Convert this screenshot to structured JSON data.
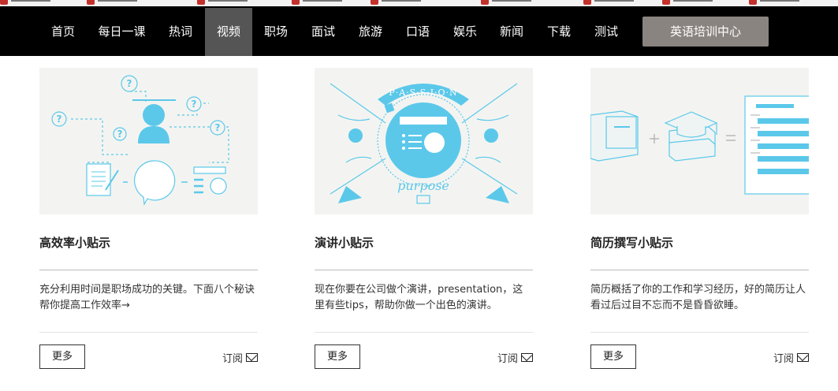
{
  "nav": {
    "items": [
      {
        "label": "首页"
      },
      {
        "label": "每日一课"
      },
      {
        "label": "热词"
      },
      {
        "label": "视频"
      },
      {
        "label": "职场"
      },
      {
        "label": "面试"
      },
      {
        "label": "旅游"
      },
      {
        "label": "口语"
      },
      {
        "label": "娱乐"
      },
      {
        "label": "新闻"
      },
      {
        "label": "下载"
      },
      {
        "label": "测试"
      }
    ],
    "active": "视频",
    "cta_label": "英语培训中心"
  },
  "cards": [
    {
      "title": "高效率小贴示",
      "desc": "充分利用时间是职场成功的关键。下面八个秘诀帮你提高工作效率→",
      "more_label": "更多",
      "subscribe_label": "订阅"
    },
    {
      "title": "演讲小贴示",
      "desc": "现在你要在公司做个演讲，presentation，这里有些tips，帮助你做一个出色的演讲。",
      "more_label": "更多",
      "subscribe_label": "订阅",
      "thumb_text": [
        "P·A·S·S·I·O·N",
        "purpose"
      ]
    },
    {
      "title": "简历撰写小贴示",
      "desc": "简历概括了你的工作和学习经历，好的简历让人看过后过目不忘而不是昏昏欲睡。",
      "more_label": "更多",
      "subscribe_label": "订阅"
    }
  ],
  "colors": {
    "nav_bg": "#000000",
    "nav_active_bg": "#555555",
    "cta_bg": "#8a8480",
    "illustration_blue": "#5bc8ea"
  }
}
